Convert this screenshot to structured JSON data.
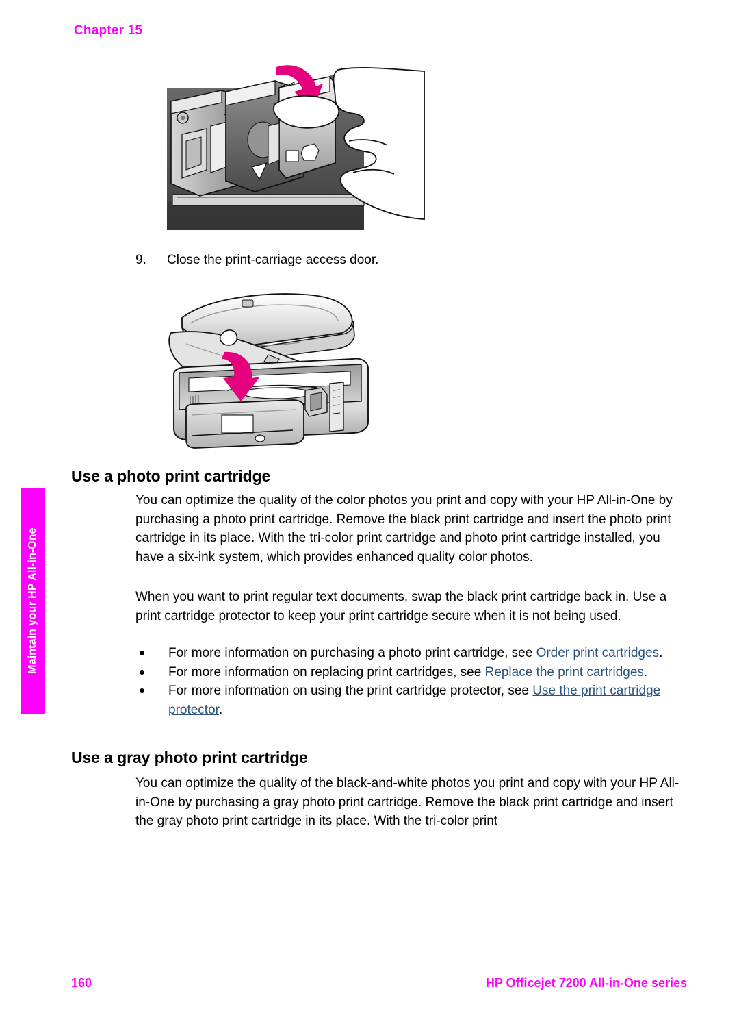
{
  "page": {
    "chapter_label": "Chapter 15",
    "side_tab_label": "Maintain your HP All-in-One",
    "accent_color": "#ff00ff",
    "link_color": "#2b5580",
    "footer": {
      "page_number": "160",
      "product_name": "HP Officejet 7200 All-in-One series"
    }
  },
  "figures": {
    "carriage": {
      "name": "print-carriage-with-finger-pressing-cartridge",
      "arrow_color": "#e5007d",
      "arrow_direction": "down"
    },
    "printer": {
      "name": "all-in-one-printer-closing-access-door",
      "arrow_color": "#e5007d",
      "arrow_direction": "down-curved"
    }
  },
  "steps": [
    {
      "number": "9.",
      "text": "Close the print-carriage access door."
    }
  ],
  "sections": [
    {
      "heading": "Use a photo print cartridge",
      "paragraphs": [
        "You can optimize the quality of the color photos you print and copy with your HP All-in-One by purchasing a photo print cartridge. Remove the black print cartridge and insert the photo print cartridge in its place. With the tri-color print cartridge and photo print cartridge installed, you have a six-ink system, which provides enhanced quality color photos.",
        "When you want to print regular text documents, swap the black print cartridge back in. Use a print cartridge protector to keep your print cartridge secure when it is not being used."
      ],
      "bullets": [
        {
          "lead": "For more information on purchasing a photo print cartridge, see ",
          "link": "Order print cartridges",
          "tail": "."
        },
        {
          "lead": "For more information on replacing print cartridges, see ",
          "link": "Replace the print cartridges",
          "tail": "."
        },
        {
          "lead": "For more information on using the print cartridge protector, see ",
          "link": "Use the print cartridge protector",
          "tail": "."
        }
      ]
    },
    {
      "heading": "Use a gray photo print cartridge",
      "paragraphs": [
        "You can optimize the quality of the black-and-white photos you print and copy with your HP All-in-One by purchasing a gray photo print cartridge. Remove the black print cartridge and insert the gray photo print cartridge in its place. With the tri-color print"
      ]
    }
  ]
}
